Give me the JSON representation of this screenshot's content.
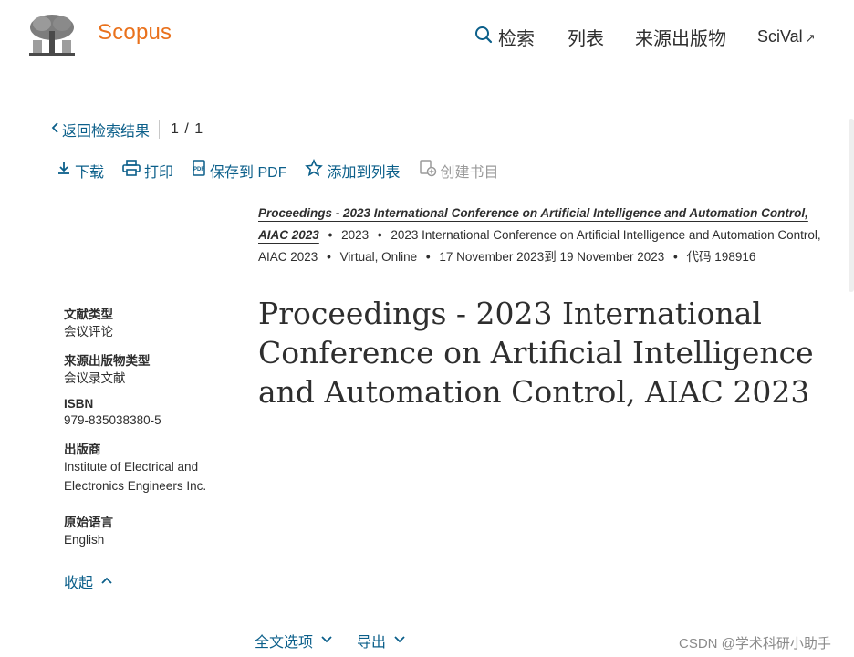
{
  "header": {
    "brand": "Scopus",
    "nav": {
      "search": "检索",
      "lists": "列表",
      "sources": "来源出版物",
      "scival": "SciVal",
      "scival_ext": "↗"
    }
  },
  "backrow": {
    "back_label": "返回检索结果",
    "pager": "1 / 1"
  },
  "toolbar": {
    "download": "下载",
    "print": "打印",
    "save_pdf": "保存到 PDF",
    "add_to_list": "添加到列表",
    "create_bib": "创建书目"
  },
  "source": {
    "title": "Proceedings - 2023 International Conference on Artificial Intelligence and Automation Control, AIAC 2023",
    "year": "2023",
    "conference": "2023 International Conference on Artificial Intelligence and Automation Control, AIAC 2023",
    "location": "Virtual, Online",
    "dates": "17 November 2023到 19 November 2023",
    "code": "代码 198916"
  },
  "meta": {
    "doc_type_label": "文献类型",
    "doc_type": "会议评论",
    "source_type_label": "来源出版物类型",
    "source_type": "会议录文献",
    "isbn_label": "ISBN",
    "isbn": "979-835038380-5",
    "publisher_label": "出版商",
    "publisher_line1": "Institute of Electrical and",
    "publisher_line2": "Electronics Engineers Inc.",
    "language_label": "原始语言",
    "language": "English",
    "collapse": "收起"
  },
  "main_title": "Proceedings - 2023 International Conference on Artificial Intelligence and Automation Control, AIAC 2023",
  "bottom": {
    "fulltext": "全文选项",
    "export": "导出"
  },
  "watermark": "CSDN @学术科研小助手"
}
